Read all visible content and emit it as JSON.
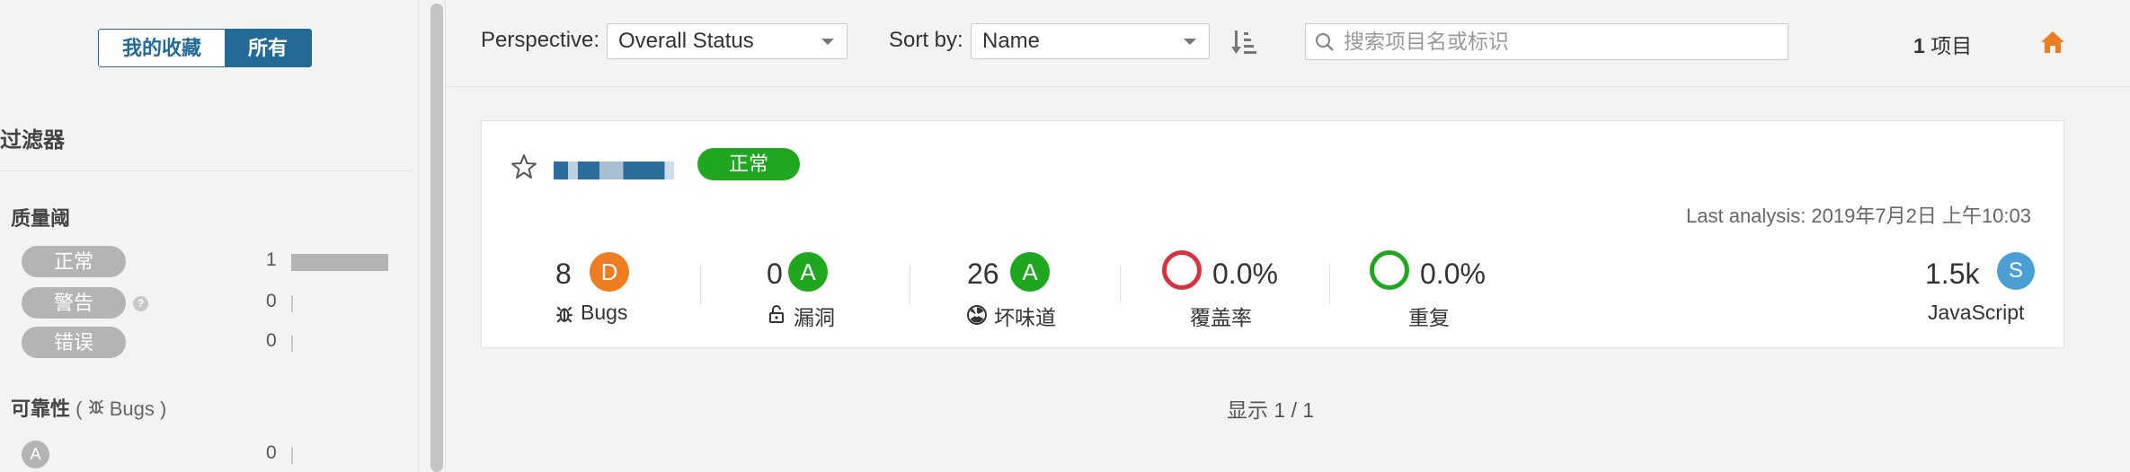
{
  "sidebar": {
    "toggle": {
      "favorites_label": "我的收藏",
      "all_label": "所有"
    },
    "filter_title": "过滤器",
    "quality_gate": {
      "title": "质量阈",
      "rows": [
        {
          "label": "正常",
          "count": "1",
          "fraction": 1.0
        },
        {
          "label": "警告",
          "count": "0",
          "fraction": 0.0
        },
        {
          "label": "错误",
          "count": "0",
          "fraction": 0.0
        }
      ]
    },
    "reliability": {
      "title": "可靠性",
      "paren_open": "(",
      "sub": "Bugs",
      "paren_close": ")",
      "rows": [
        {
          "label": "A",
          "count": "0",
          "fraction": 0.0
        }
      ]
    }
  },
  "topbar": {
    "perspective_label": "Perspective:",
    "perspective_value": "Overall Status",
    "sort_label": "Sort by:",
    "sort_value": "Name",
    "search_placeholder": "搜索项目名或标识",
    "project_count": "1",
    "project_count_suffix": "项目"
  },
  "project": {
    "status": "正常",
    "last_analysis": "Last analysis: 2019年7月2日 上午10:03",
    "measures": {
      "bugs": {
        "value": "8",
        "grade": "D",
        "label": "Bugs"
      },
      "vulnerabilities": {
        "value": "0",
        "grade": "A",
        "label": "漏洞"
      },
      "code_smells": {
        "value": "26",
        "grade": "A",
        "label": "坏味道"
      },
      "coverage": {
        "value": "0.0%",
        "label": "覆盖率"
      },
      "duplications": {
        "value": "0.0%",
        "label": "重复"
      },
      "size": {
        "value": "1.5k",
        "grade": "S",
        "label": "JavaScript"
      }
    }
  },
  "footer": {
    "showing": "显示 1 / 1"
  },
  "colors": {
    "brand": "#236a97",
    "ok": "#1fa71f",
    "grade_d": "#ed7d20",
    "error": "#d4333f",
    "home": "#ed7d20",
    "size_badge": "#4b9fd5"
  }
}
